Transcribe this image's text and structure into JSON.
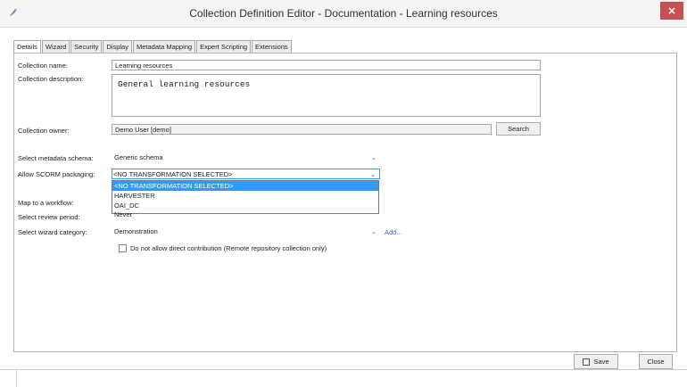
{
  "window": {
    "title": "Collection Definition Editor - Documentation - Learning resources",
    "close_glyph": "×",
    "app_icon": "feather-icon"
  },
  "tabs": [
    {
      "label": "Details",
      "active": true
    },
    {
      "label": "Wizard"
    },
    {
      "label": "Security"
    },
    {
      "label": "Display"
    },
    {
      "label": "Metadata Mapping"
    },
    {
      "label": "Expert Scripting"
    },
    {
      "label": "Extensions"
    }
  ],
  "form": {
    "name_label": "Collection name:",
    "name_value": "Learning resources",
    "description_label": "Collection description:",
    "description_value": "General learning resources",
    "owner_label": "Collection owner:",
    "owner_value": "Demo User [demo]",
    "search_label": "Search",
    "schema_label": "Select metadata schema:",
    "schema_value": "Generic schema",
    "scorm_label": "Allow SCORM packaging:",
    "scorm_value": "<NO TRANSFORMATION SELECTED>",
    "scorm_options": [
      "<NO TRANSFORMATION SELECTED>",
      "HARVESTER",
      "OAI_DC"
    ],
    "workflow_label": "Map to a workflow:",
    "review_label": "Select review period:",
    "review_value": "Never",
    "wizard_category_label": "Select wizard category:",
    "wizard_category_value": "Demonstration",
    "add_link": "Add...",
    "direct_contribution_label": "Do not allow direct contribution (Remote repository collection only)"
  },
  "actions": {
    "save_label": "Save",
    "close_label": "Close"
  },
  "colors": {
    "close_button": "#c75050",
    "selection": "#3399ff",
    "link": "#3a6fc4"
  }
}
